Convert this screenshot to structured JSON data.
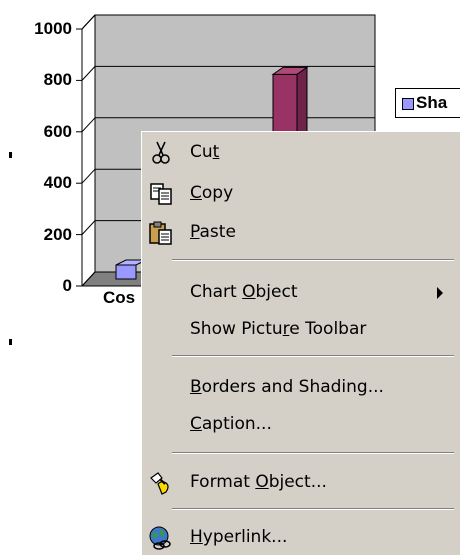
{
  "chart_data": {
    "type": "bar",
    "categories": [
      "Cos"
    ],
    "series": [
      {
        "name": "Sha",
        "values": [
          800
        ]
      }
    ],
    "yticks": [
      "0",
      "200",
      "400",
      "600",
      "800",
      "1000"
    ],
    "ylim": [
      0,
      1000
    ],
    "xlabel": "",
    "ylabel": "",
    "title": "",
    "colors": {
      "series_main": "#993366",
      "series_low": "#9999ff",
      "plot_bg": "#c0c0c0"
    },
    "legend_position": "right"
  },
  "context_menu": {
    "items": [
      {
        "id": "cut",
        "before": "Cu",
        "mnemonic": "t",
        "after": "",
        "icon": "scissors-icon"
      },
      {
        "id": "copy",
        "before": "",
        "mnemonic": "C",
        "after": "opy",
        "icon": "copy-icon"
      },
      {
        "id": "paste",
        "before": "",
        "mnemonic": "P",
        "after": "aste",
        "icon": "paste-icon"
      },
      {
        "id": "chart-object",
        "before": "Chart ",
        "mnemonic": "O",
        "after": "bject",
        "icon": ""
      },
      {
        "id": "show-picture-toolbar",
        "before": "Show Pictu",
        "mnemonic": "r",
        "after": "e Toolbar",
        "icon": ""
      },
      {
        "id": "borders-shading",
        "before": "",
        "mnemonic": "B",
        "after": "orders and Shading...",
        "icon": ""
      },
      {
        "id": "caption",
        "before": "",
        "mnemonic": "C",
        "after": "aption...",
        "icon": ""
      },
      {
        "id": "format-object",
        "before": "Format ",
        "mnemonic": "O",
        "after": "bject...",
        "icon": "format-object-icon"
      },
      {
        "id": "hyperlink",
        "before": "",
        "mnemonic": "H",
        "after": "yperlink...",
        "icon": "hyperlink-icon"
      }
    ]
  }
}
